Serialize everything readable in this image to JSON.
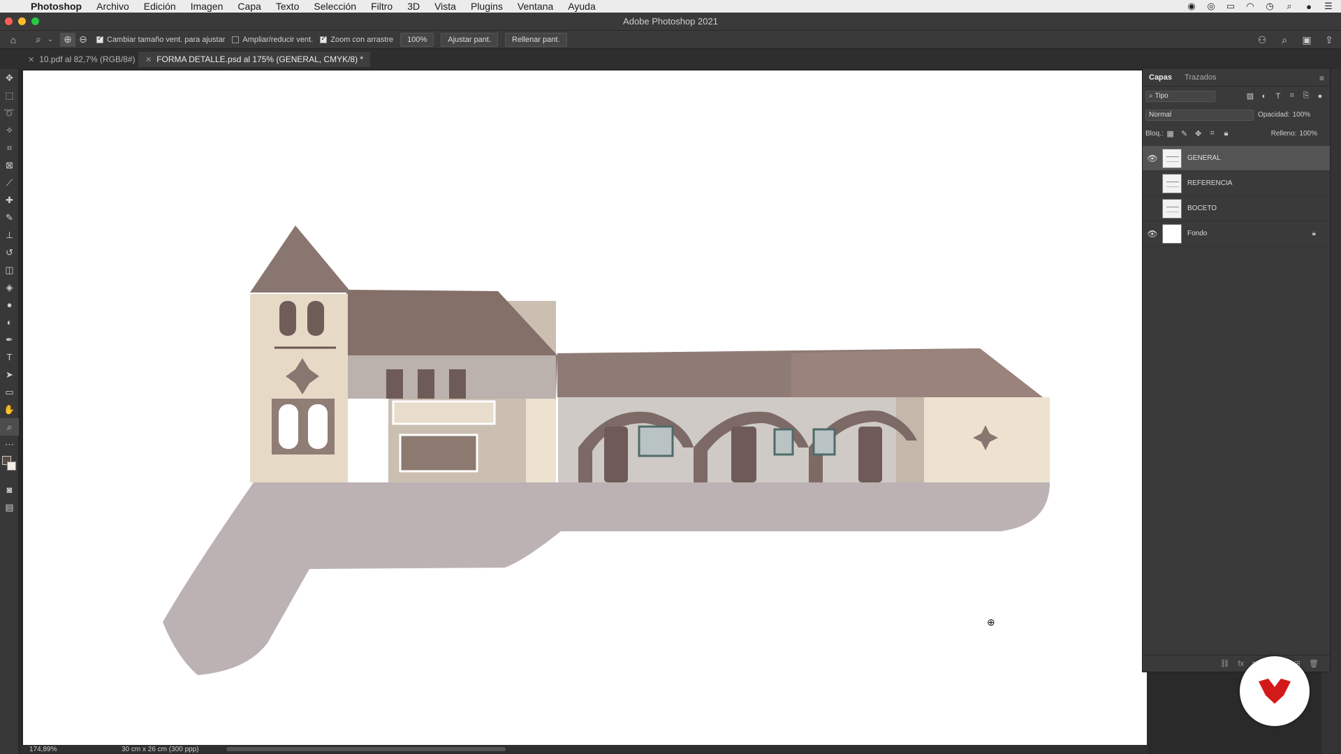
{
  "menubar": {
    "app": "Photoshop",
    "items": [
      "Archivo",
      "Edición",
      "Imagen",
      "Capa",
      "Texto",
      "Selección",
      "Filtro",
      "3D",
      "Vista",
      "Plugins",
      "Ventana",
      "Ayuda"
    ]
  },
  "window": {
    "title": "Adobe Photoshop 2021"
  },
  "options": {
    "resize_windows": "Cambiar tamaño vent. para ajustar",
    "zoom_all_windows": "Ampliar/reducir vent.",
    "scrubby_zoom": "Zoom con arrastre",
    "zoom_value": "100%",
    "fit_screen": "Ajustar pant.",
    "fill_screen": "Rellenar pant."
  },
  "tabs": [
    {
      "label": "10.pdf al 82,7% (RGB/8#)"
    },
    {
      "label": "FORMA DETALLE.psd al 175% (GENERAL, CMYK/8) *"
    }
  ],
  "layers_panel": {
    "tabs": [
      "Capas",
      "Trazados"
    ],
    "filter": "Tipo",
    "blend_mode": "Normal",
    "opacity_label": "Opacidad:",
    "opacity_value": "100%",
    "lock_label": "Bloq.:",
    "fill_label": "Relleno:",
    "fill_value": "100%",
    "layers": [
      {
        "name": "GENERAL",
        "visible": true,
        "selected": true
      },
      {
        "name": "REFERENCIA",
        "visible": false
      },
      {
        "name": "BOCETO",
        "visible": false
      },
      {
        "name": "Fondo",
        "visible": true,
        "locked": true
      }
    ]
  },
  "status": {
    "zoom": "174,89%",
    "doc_size": "30 cm x 26 cm (300 ppp)"
  },
  "colors": {
    "accent_red": "#d41919",
    "roof": "#8a7670",
    "wall": "#ede2cf",
    "ground": "#bcb1b3"
  }
}
